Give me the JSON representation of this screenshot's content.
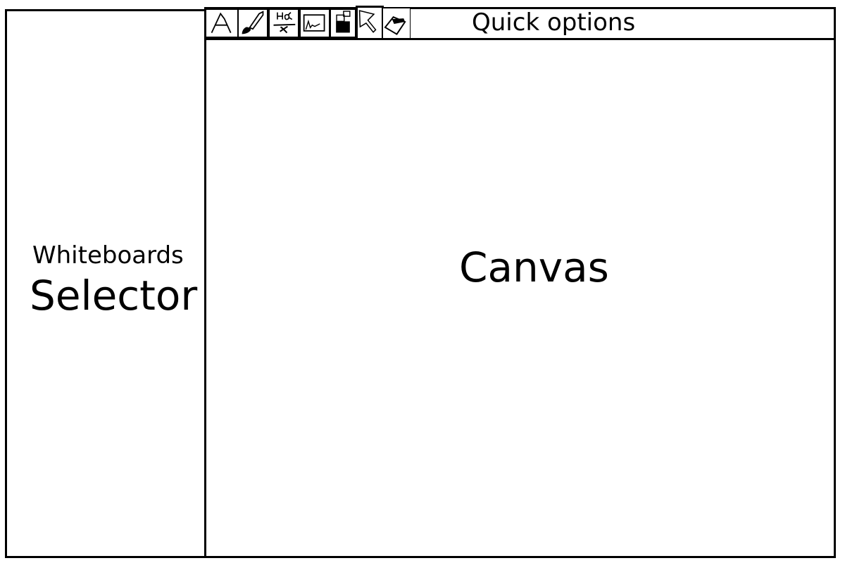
{
  "sidebar": {
    "title_small": "Whiteboards",
    "title_big": "Selector"
  },
  "canvas": {
    "label": "Canvas"
  },
  "toolbar": {
    "label": "Quick options",
    "tools": [
      {
        "icon": "text-icon"
      },
      {
        "icon": "brush-icon"
      },
      {
        "icon": "formula-icon"
      },
      {
        "icon": "image-icon"
      },
      {
        "icon": "paste-icon"
      },
      {
        "icon": "pointer-icon",
        "selected": true
      },
      {
        "icon": "eraser-icon"
      }
    ]
  }
}
